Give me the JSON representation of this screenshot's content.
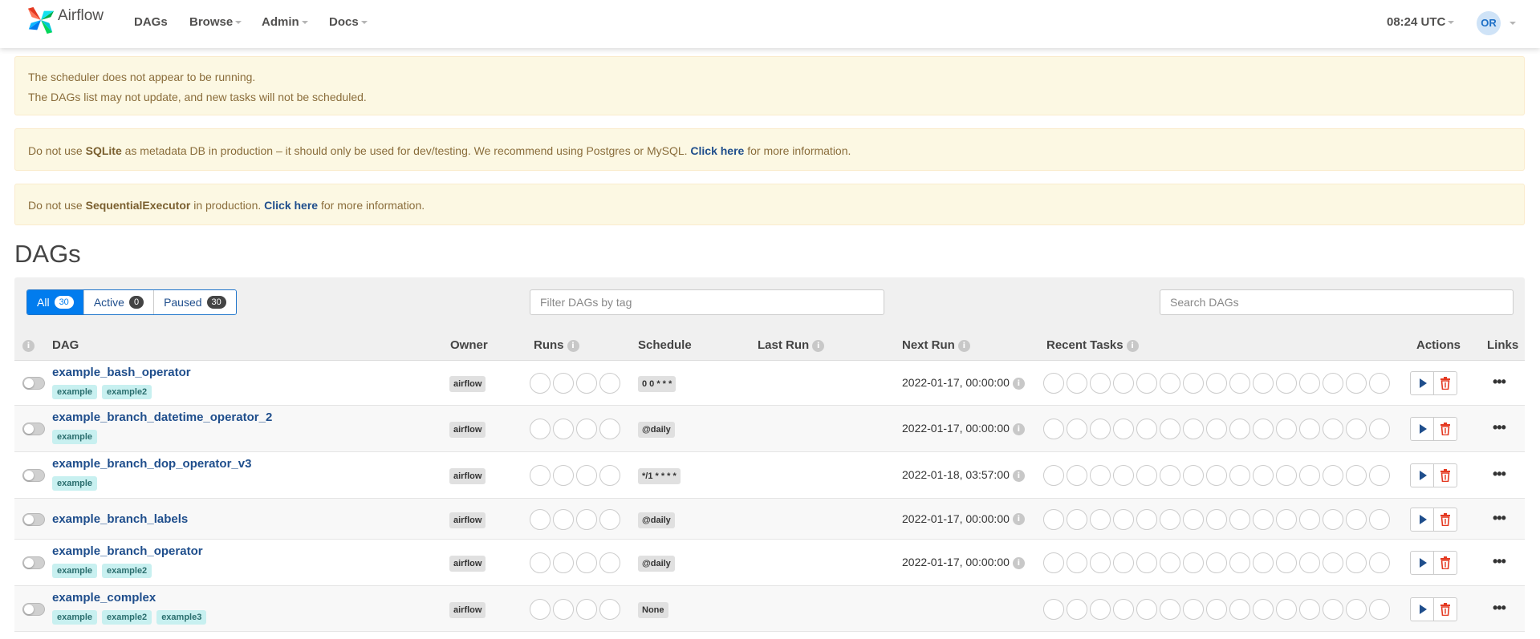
{
  "navbar": {
    "brand": "Airflow",
    "menu": [
      {
        "label": "DAGs",
        "dropdown": false
      },
      {
        "label": "Browse",
        "dropdown": true
      },
      {
        "label": "Admin",
        "dropdown": true
      },
      {
        "label": "Docs",
        "dropdown": true
      }
    ],
    "clock": "08:24 UTC",
    "user_initials": "OR"
  },
  "alerts": {
    "scheduler_line1": "The scheduler does not appear to be running.",
    "scheduler_line2": "The DAGs list may not update, and new tasks will not be scheduled.",
    "sqlite_pre": "Do not use ",
    "sqlite_bold": "SQLite",
    "sqlite_mid": " as metadata DB in production – it should only be used for dev/testing. We recommend using Postgres or MySQL. ",
    "sqlite_link": "Click here",
    "sqlite_post": " for more information.",
    "executor_pre": "Do not use ",
    "executor_bold": "SequentialExecutor",
    "executor_mid": " in production. ",
    "executor_link": "Click here",
    "executor_post": " for more information."
  },
  "page_title": "DAGs",
  "filters": {
    "all_label": "All",
    "all_count": "30",
    "active_label": "Active",
    "active_count": "0",
    "paused_label": "Paused",
    "paused_count": "30",
    "tag_placeholder": "Filter DAGs by tag",
    "search_placeholder": "Search DAGs"
  },
  "columns": {
    "dag": "DAG",
    "owner": "Owner",
    "runs": "Runs",
    "schedule": "Schedule",
    "last_run": "Last Run",
    "next_run": "Next Run",
    "recent_tasks": "Recent Tasks",
    "actions": "Actions",
    "links": "Links",
    "info_glyph": "i"
  },
  "dags": [
    {
      "name": "example_bash_operator",
      "tags": [
        "example",
        "example2"
      ],
      "owner": "airflow",
      "schedule": "0 0 * * *",
      "next_run": "2022-01-17, 00:00:00"
    },
    {
      "name": "example_branch_datetime_operator_2",
      "tags": [
        "example"
      ],
      "owner": "airflow",
      "schedule": "@daily",
      "next_run": "2022-01-17, 00:00:00"
    },
    {
      "name": "example_branch_dop_operator_v3",
      "tags": [
        "example"
      ],
      "owner": "airflow",
      "schedule": "*/1 * * * *",
      "next_run": "2022-01-18, 03:57:00"
    },
    {
      "name": "example_branch_labels",
      "tags": [],
      "owner": "airflow",
      "schedule": "@daily",
      "next_run": "2022-01-17, 00:00:00"
    },
    {
      "name": "example_branch_operator",
      "tags": [
        "example",
        "example2"
      ],
      "owner": "airflow",
      "schedule": "@daily",
      "next_run": "2022-01-17, 00:00:00"
    },
    {
      "name": "example_complex",
      "tags": [
        "example",
        "example2",
        "example3"
      ],
      "owner": "airflow",
      "schedule": "None",
      "next_run": ""
    }
  ],
  "links_glyph": "•••",
  "colors": {
    "accent": "#017cee",
    "alert_bg": "#fcf8e3",
    "alert_text": "#8a6d3b",
    "link": "#1f4e8c",
    "delete": "#e43921"
  }
}
